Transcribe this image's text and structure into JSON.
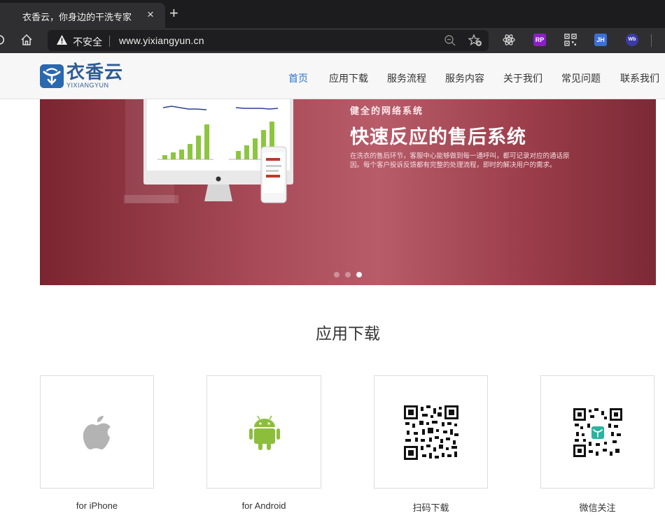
{
  "browser": {
    "tab_title": "衣香云，你身边的干洗专家",
    "tab_close": "×",
    "new_tab": "+",
    "security_label": "不安全",
    "url": "www.yixiangyun.cn",
    "extensions": [
      "RP",
      "JH",
      "Wb"
    ]
  },
  "site": {
    "logo_text": "衣香云",
    "logo_sub": "YIXIANGYUN",
    "nav": [
      "首页",
      "应用下载",
      "服务流程",
      "服务内容",
      "关于我们",
      "常见问题",
      "联系我们"
    ],
    "nav_active_index": 0
  },
  "banner": {
    "kicker": "健全的网络系统",
    "title": "快速反应的售后系统",
    "description": "在洗衣的售后环节，客服中心能够做到每一通呼叫，都可记录对应的通话原因。每个客户投诉反馈都有完整的处理流程，即时的解决用户的需求。",
    "slide_count": 3,
    "active_slide": 3
  },
  "downloads": {
    "title": "应用下载",
    "items": [
      {
        "label": "for iPhone",
        "icon": "apple-icon"
      },
      {
        "label": "for Android",
        "icon": "android-icon"
      },
      {
        "label": "扫码下载",
        "icon": "qr-code-icon"
      },
      {
        "label": "微信关注",
        "icon": "wechat-qr-code-icon"
      }
    ]
  },
  "colors": {
    "browser_bg": "#1c1c1e",
    "nav_active": "#2a73c8",
    "banner": "#a84a58",
    "android_green": "#8cbe3c",
    "apple_grey": "#b3b3b3"
  }
}
